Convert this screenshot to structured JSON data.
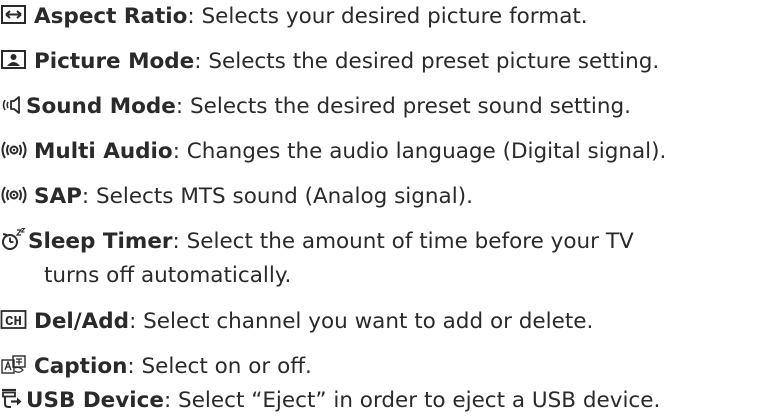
{
  "items": [
    {
      "icon": "aspect-ratio-icon",
      "label": "Aspect Ratio",
      "desc": ": Selects your desired picture format."
    },
    {
      "icon": "picture-mode-icon",
      "label": "Picture Mode",
      "desc": ": Selects the desired preset picture setting."
    },
    {
      "icon": "sound-mode-icon",
      "label": "Sound Mode",
      "desc": ": Selects the desired preset sound setting."
    },
    {
      "icon": "multi-audio-icon",
      "label": "Multi Audio",
      "desc": ": Changes the audio language (Digital signal)."
    },
    {
      "icon": "sap-icon",
      "label": "SAP",
      "desc": ": Selects MTS sound (Analog signal)."
    },
    {
      "icon": "sleep-timer-icon",
      "label": "Sleep Timer",
      "desc": ": Select the amount of time before your TV",
      "desc2": "turns off automatically."
    },
    {
      "icon": "channel-icon",
      "icon_text": "CH",
      "label": "Del/Add",
      "desc": ": Select channel you want to add or delete."
    },
    {
      "icon": "caption-icon",
      "label": "Caption",
      "desc": ": Select on or off."
    },
    {
      "icon": "usb-device-icon",
      "label": "USB Device",
      "desc": ": Select “Eject” in order to eject a USB device."
    }
  ]
}
